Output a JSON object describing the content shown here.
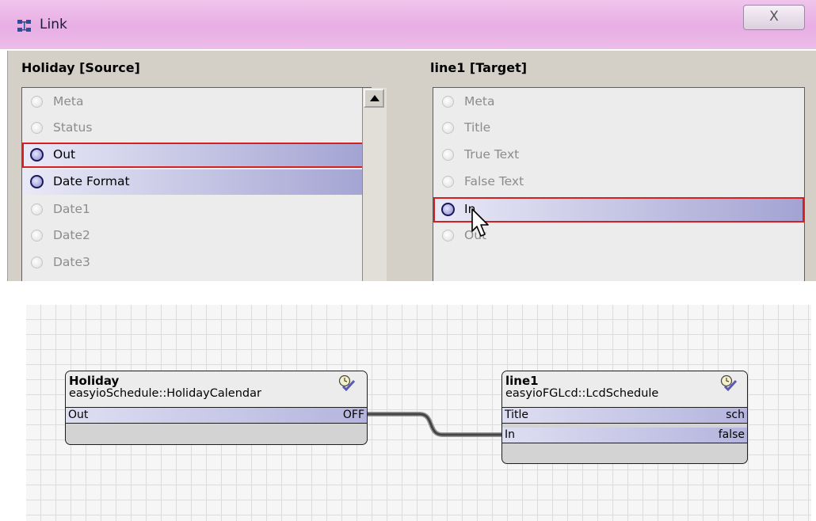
{
  "dialog": {
    "title": "Link",
    "close_label": "X",
    "source": {
      "title": "Holiday [Source]",
      "slots": [
        {
          "label": "Meta",
          "state": "disabled"
        },
        {
          "label": "Status",
          "state": "disabled"
        },
        {
          "label": "Out",
          "state": "selected"
        },
        {
          "label": "Date Format",
          "state": "active"
        },
        {
          "label": "Date1",
          "state": "disabled"
        },
        {
          "label": "Date2",
          "state": "disabled"
        },
        {
          "label": "Date3",
          "state": "disabled"
        }
      ]
    },
    "target": {
      "title": "line1 [Target]",
      "slots": [
        {
          "label": "Meta",
          "state": "disabled"
        },
        {
          "label": "Title",
          "state": "disabled"
        },
        {
          "label": "True Text",
          "state": "disabled"
        },
        {
          "label": "False Text",
          "state": "disabled"
        },
        {
          "label": "In",
          "state": "selected"
        },
        {
          "label": "Out",
          "state": "disabled"
        }
      ]
    }
  },
  "wiresheet": {
    "blocks": {
      "holiday": {
        "name": "Holiday",
        "type": "easyioSchedule::HolidayCalendar",
        "icon": "schedule-check-icon",
        "slots": [
          {
            "name": "Out",
            "value": "OFF"
          }
        ]
      },
      "line1": {
        "name": "line1",
        "type": "easyioFGLcd::LcdSchedule",
        "icon": "schedule-check-icon",
        "slots": [
          {
            "name": "Title",
            "value": "sch"
          },
          {
            "name": "In",
            "value": "false"
          }
        ]
      }
    }
  },
  "colors": {
    "titlebar": "#e7aee3",
    "selection_border": "#d42020",
    "active_slot": "#a3a3d3",
    "wire": "#444444"
  }
}
